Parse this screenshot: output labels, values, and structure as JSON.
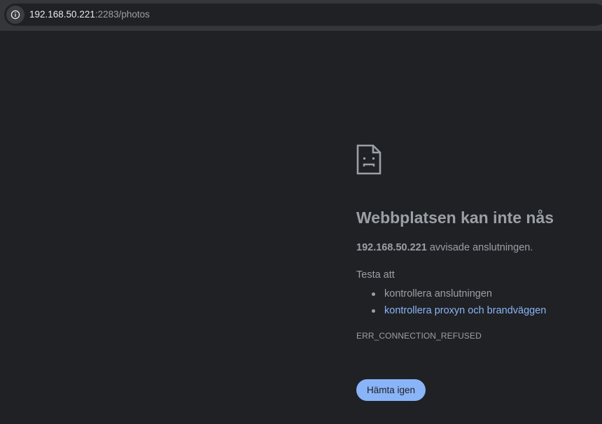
{
  "browser": {
    "url_host": "192.168.50.221",
    "url_rest": ":2283/photos",
    "site_info_icon": "info-icon"
  },
  "error_page": {
    "icon": "sad-page-icon",
    "heading": "Webbplatsen kan inte nås",
    "detail_host": "192.168.50.221",
    "detail_text": " avvisade anslutningen.",
    "try_label": "Testa att",
    "suggestions": [
      "kontrollera anslutningen",
      "kontrollera proxyn och brandväggen"
    ],
    "error_code": "ERR_CONNECTION_REFUSED",
    "reload_label": "Hämta igen"
  },
  "colors": {
    "background": "#202124",
    "text": "#9aa0a6",
    "link": "#8ab4f8",
    "button": "#8ab4f8"
  }
}
